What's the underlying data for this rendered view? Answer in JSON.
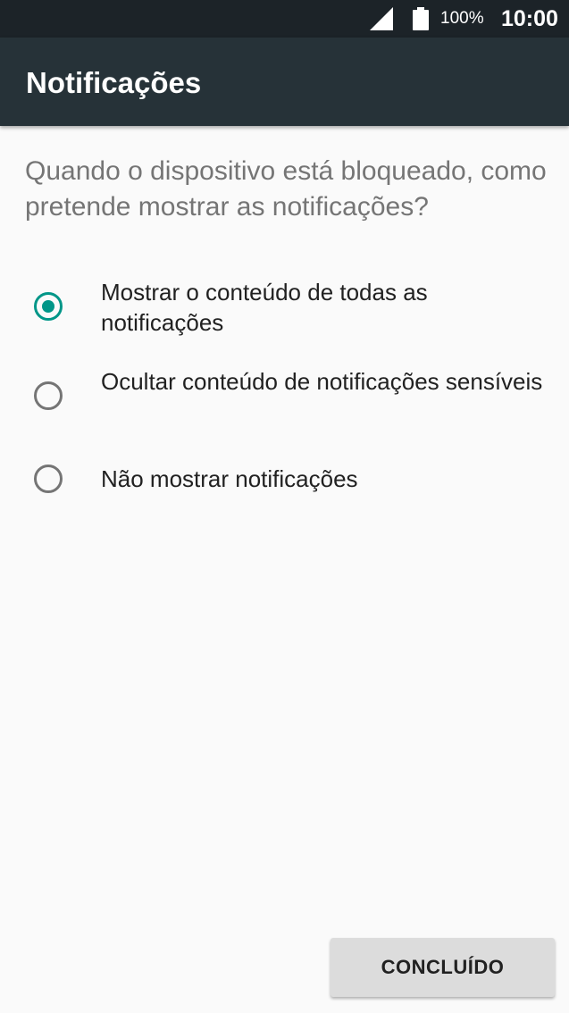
{
  "status_bar": {
    "signal_icon": "cell-signal-icon",
    "battery_icon": "battery-full-icon",
    "battery_percent": "100%",
    "time": "10:00"
  },
  "app_bar": {
    "title": "Notificações"
  },
  "prompt": {
    "question": "Quando o dispositivo está bloqueado, como pretende mostrar as notificações?"
  },
  "options": [
    {
      "label": "Mostrar o conteúdo de todas as notificações",
      "selected": true
    },
    {
      "label": "Ocultar conteúdo de notificações sensíveis",
      "selected": false
    },
    {
      "label": "Não mostrar notificações",
      "selected": false
    }
  ],
  "footer": {
    "done_label": "CONCLUÍDO"
  },
  "colors": {
    "accent": "#009688",
    "app_bar": "#263238",
    "status_bar": "#1c2328"
  }
}
